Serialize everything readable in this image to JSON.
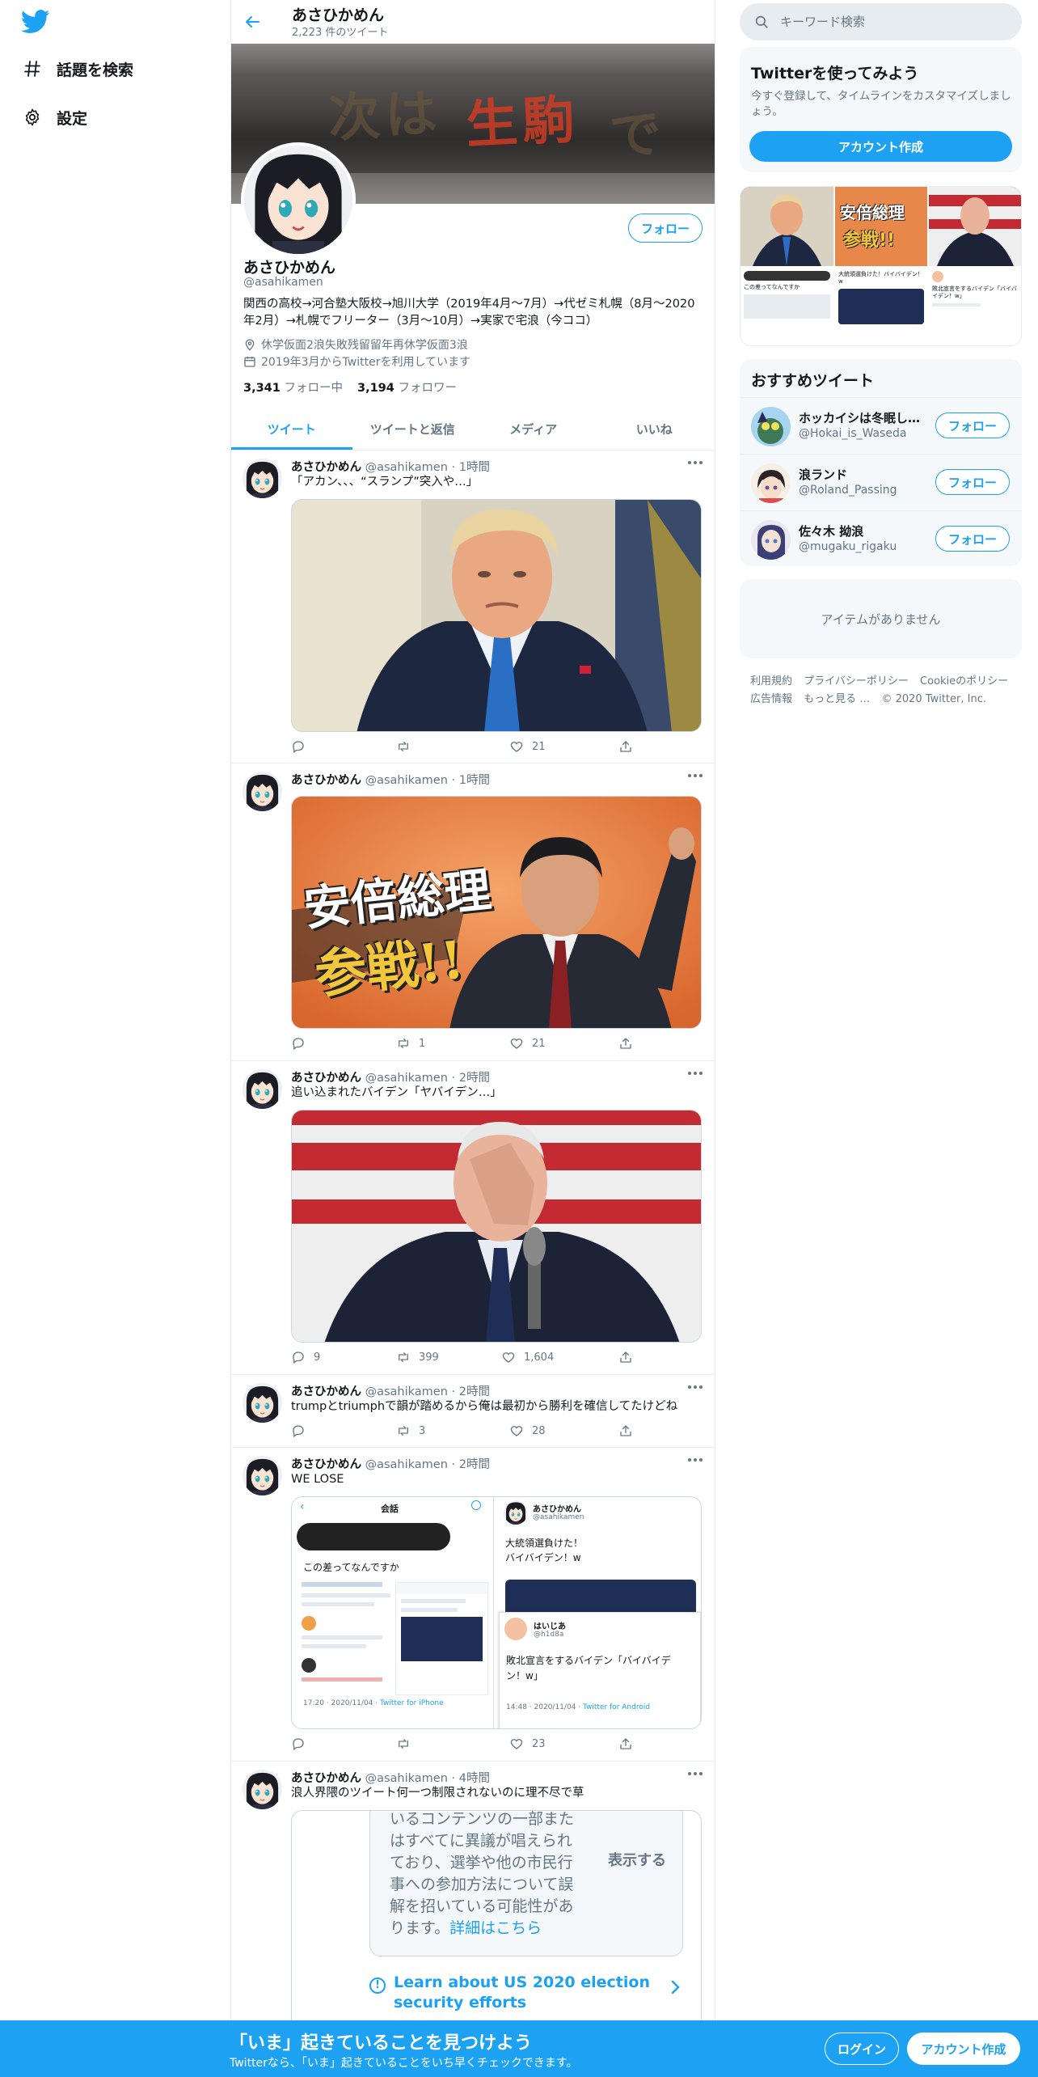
{
  "nav": {
    "logo": "twitter-bird",
    "items": [
      {
        "label": "話題を検索",
        "icon": "hashtag-icon"
      },
      {
        "label": "設定",
        "icon": "gear-icon"
      }
    ]
  },
  "header": {
    "title": "あさひかめん",
    "tweet_count": "2,223 件のツイート"
  },
  "banner_text": {
    "line1": "次は",
    "line2": "生駒",
    "line3": "です"
  },
  "profile": {
    "name": "あさひかめん",
    "handle": "@asahikamen",
    "follow_label": "フォロー",
    "bio": "関西の高校→河合塾大阪校→旭川大学（2019年4月〜7月）→代ゼミ札幌（8月〜2020年2月）→札幌でフリーター（3月〜10月）→実家で宅浪（今ココ）",
    "location": "休学仮面2浪失敗残留留年再休学仮面3浪",
    "joined": "2019年3月からTwitterを利用しています",
    "following_count": "3,341",
    "following_label": "フォロー中",
    "followers_count": "3,194",
    "followers_label": "フォロワー"
  },
  "tabs": [
    "ツイート",
    "ツイートと返信",
    "メディア",
    "いいね"
  ],
  "tweets": [
    {
      "name": "あさひかめん",
      "handle": "@asahikamen",
      "time": "1時間",
      "text": "「アカン、、、“スランプ”突入や…」",
      "reply": "",
      "retweet": "",
      "like": "21"
    },
    {
      "name": "あさひかめん",
      "handle": "@asahikamen",
      "time": "1時間",
      "text": "",
      "reply": "",
      "retweet": "1",
      "like": "21",
      "media_line1": "安倍総理",
      "media_line2": "参戦!!"
    },
    {
      "name": "あさひかめん",
      "handle": "@asahikamen",
      "time": "2時間",
      "text": "追い込まれたバイデン「ヤバイデン…」",
      "reply": "9",
      "retweet": "399",
      "like": "1,604"
    },
    {
      "name": "あさひかめん",
      "handle": "@asahikamen",
      "time": "2時間",
      "text": "trumpとtriumphで韻が踏めるから俺は最初から勝利を確信してたけどね",
      "reply": "",
      "retweet": "3",
      "like": "28"
    },
    {
      "name": "あさひかめん",
      "handle": "@asahikamen",
      "time": "2時間",
      "text": "WE LOSE",
      "reply": "",
      "retweet": "",
      "like": "23",
      "ss": {
        "left_header": "会話",
        "left_question": "この差ってなんですか",
        "left_meta": "17:20 · 2020/11/04 · ",
        "left_client": "Twitter for iPhone",
        "r1_name": "あさひかめん",
        "r1_handle": "@asahikamen",
        "r1_text1": "大統領選負けた！",
        "r1_text2": "バイバイデン！w",
        "r2_name": "はいじあ",
        "r2_handle": "@h1d8a",
        "r2_text1": "敗北宣言をするバイデン「バイバイデ",
        "r2_text2": "ン！w」",
        "r2_meta": "14:48 · 2020/11/04 · ",
        "r2_client": "Twitter for Android"
      }
    },
    {
      "name": "あさひかめん",
      "handle": "@asahikamen",
      "time": "4時間",
      "text": "浪人界隈のツイート何一つ制限されないのに理不尽で草",
      "notice": {
        "l1": "いるコンテンツの一部また",
        "l2": "はすべてに異議が唱えられ",
        "l3": "ており、選挙や他の市民行",
        "l4": "事への参加方法について誤",
        "l5": "解を招いている可能性があ",
        "l6": "ります。",
        "link": "詳細はこちら",
        "show": "表示する",
        "election1": "Learn about US 2020 election",
        "election2": "security efforts"
      }
    }
  ],
  "right": {
    "search_placeholder": "キーワード検索",
    "signup_title": "Twitterを使ってみよう",
    "signup_desc": "今すぐ登録して、タイムラインをカスタマイズしましょう。",
    "signup_button": "アカウント作成",
    "grid_labels": {
      "abe1": "安倍総理",
      "abe2": "参戦!!",
      "caption1": "この差ってなんですか",
      "caption2": "大統領選負けた！バイバイデン！w",
      "caption3": "敗北宣言をするバイデン「バイバイデン！w」"
    },
    "rec_title": "おすすめツイート",
    "recommendations": [
      {
        "name": "ホッカイシは冬眠し…",
        "handle": "@Hokai_is_Waseda",
        "button": "フォロー"
      },
      {
        "name": "浪ランド",
        "handle": "@Roland_Passing",
        "button": "フォロー"
      },
      {
        "name": "佐々木 拗浪",
        "handle": "@mugaku_rigaku",
        "button": "フォロー"
      }
    ],
    "empty_text": "アイテムがありません",
    "footer": {
      "terms": "利用規約",
      "privacy": "プライバシーポリシー",
      "cookie": "Cookieのポリシー",
      "ads": "広告情報",
      "more": "もっと見る …",
      "copyright": "© 2020 Twitter, Inc."
    }
  },
  "bottom": {
    "title": "「いま」起きていることを見つけよう",
    "subtitle": "Twitterなら、「いま」起きていることをいち早くチェックできます。",
    "login": "ログイン",
    "signup": "アカウント作成"
  },
  "colors": {
    "accent": "#1da1f2",
    "text": "#14171a",
    "secondary": "#657786",
    "border": "#e6ecf0"
  }
}
